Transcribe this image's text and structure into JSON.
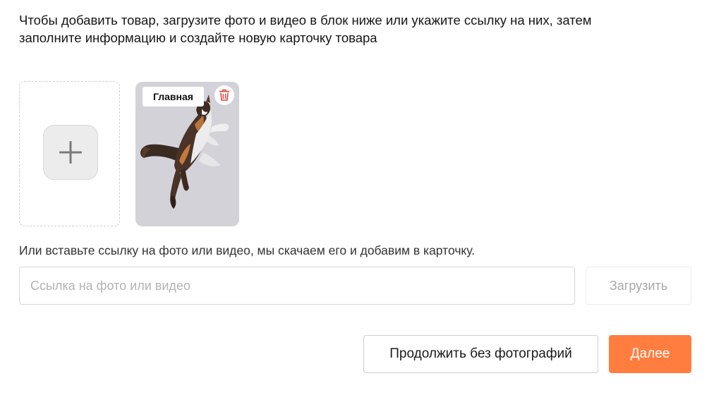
{
  "intro": {
    "line1": "Чтобы добавить товар, загрузите фото и видео в блок ниже или укажите ссылку на них, затем",
    "line2": "заполните информацию и создайте новую карточку товара"
  },
  "media": {
    "add_icon": "plus-icon",
    "items": [
      {
        "badge": "Главная",
        "delete_icon": "trash-icon",
        "image_subject": "cat"
      }
    ]
  },
  "link": {
    "hint": "Или вставьте ссылку на фото или видео, мы скачаем его и добавим в карточку.",
    "input_value": "",
    "input_placeholder": "Ссылка на фото или видео",
    "upload_label": "Загрузить"
  },
  "actions": {
    "skip_label": "Продолжить без фотографий",
    "next_label": "Далее"
  },
  "colors": {
    "accent": "#ff7d3f",
    "delete_icon": "#e8403a",
    "photo_background": "#d3d2d9"
  }
}
